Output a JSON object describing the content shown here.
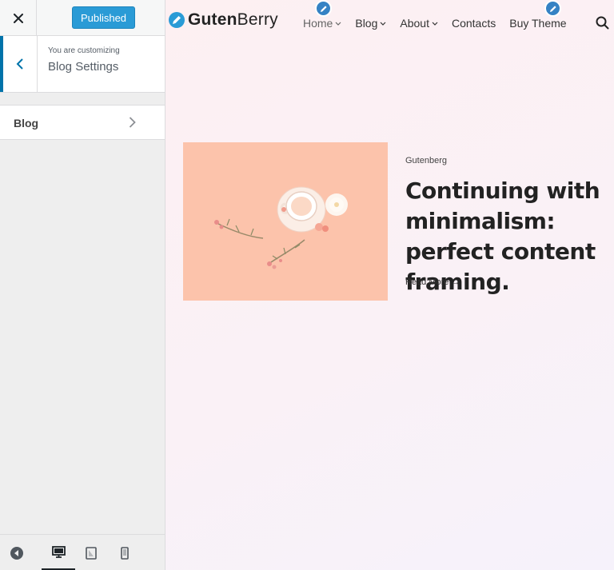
{
  "sidebar": {
    "publish_label": "Published",
    "customizing_label": "You are customizing",
    "section_title": "Blog Settings",
    "panel_items": [
      {
        "label": "Blog"
      }
    ],
    "footer": {
      "active_device": "desktop"
    }
  },
  "preview": {
    "logo_bold": "Guten",
    "logo_light": "Berry",
    "nav": [
      {
        "label": "Home"
      },
      {
        "label": "Blog"
      },
      {
        "label": "About"
      },
      {
        "label": "Contacts"
      },
      {
        "label": "Buy Theme"
      }
    ],
    "post": {
      "category": "Gutenberg",
      "title": "Continuing with minimalism: perfect content framing.",
      "read_more": "Read More →"
    }
  },
  "colors": {
    "accent": "#2a9bd6",
    "edit_badge": "#3582c4",
    "image_bg": "#fcc3ab"
  }
}
